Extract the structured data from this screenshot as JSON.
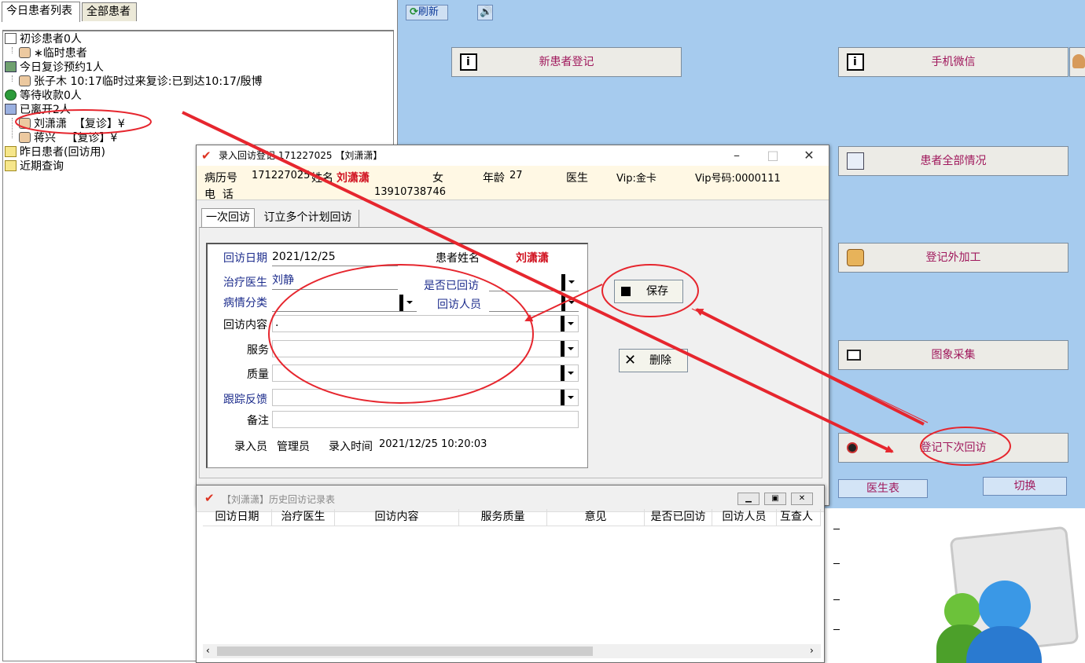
{
  "left_panel": {
    "tabs": [
      "今日患者列表",
      "全部患者"
    ],
    "tree": [
      {
        "text": "初诊患者0人",
        "icon": "document-icon"
      },
      {
        "text": "∗临时患者",
        "icon": "patient-face-icon",
        "child": true
      },
      {
        "text": "今日复诊预约1人",
        "icon": "people-icon"
      },
      {
        "text": "张子木 10:17临时过来复诊:已到达10:17/殷博",
        "icon": "patient-face-icon",
        "child": true
      },
      {
        "text": "等待收款0人",
        "icon": "money-bag-icon"
      },
      {
        "text": "已离开2人",
        "icon": "book-icon"
      },
      {
        "text": "刘潇潇  【复诊】¥",
        "icon": "patient-face-icon",
        "child": true
      },
      {
        "text": "蒋兴   【复诊】¥",
        "icon": "patient-face-icon",
        "child": true
      },
      {
        "text": "昨日患者(回访用)",
        "icon": "folder-icon"
      },
      {
        "text": "近期查询",
        "icon": "folder-icon"
      }
    ]
  },
  "toolbar": {
    "refresh": "刷新"
  },
  "right_buttons": {
    "new_patient": "新患者登记",
    "wechat": "手机微信",
    "all_info": "患者全部情况",
    "outsourcing": "登记外加工",
    "image_capture": "图象采集",
    "next_visit": "登记下次回访",
    "doctor_table": "医生表",
    "switch": "切换"
  },
  "dialog": {
    "title": "录入回访登记 171227025 【刘潇潇】",
    "header": {
      "record_label": "病历号",
      "record_no": "171227025",
      "name_label": "姓名",
      "name": "刘潇潇",
      "gender": "女",
      "age_label": "年龄",
      "age": "27",
      "doctor_label": "医生",
      "vip": "Vip:金卡",
      "vip_no": "Vip号码:0000111",
      "phone_label": "电  话",
      "phone": "13910738746"
    },
    "tabs": [
      "一次回访",
      "订立多个计划回访"
    ],
    "form": {
      "visit_date_label": "回访日期",
      "visit_date": "2021/12/25",
      "patient_name_label": "患者姓名",
      "patient_name": "刘潇潇",
      "doctor_label": "治疗医生",
      "doctor": "刘静",
      "visited_label": "是否已回访",
      "category_label": "病情分类",
      "visitor_label": "回访人员",
      "content_label": "回访内容",
      "content": ".",
      "service_label": "服务",
      "quality_label": "质量",
      "feedback_label": "跟踪反馈",
      "note_label": "备注",
      "entry_by_label": "录入员",
      "entry_by": "管理员",
      "entry_time_label": "录入时间",
      "entry_time": "2021/12/25 10:20:03"
    },
    "buttons": {
      "save": "保存",
      "delete": "删除"
    }
  },
  "history": {
    "title": "【刘潇潇】历史回访记录表",
    "columns": [
      "回访日期",
      "治疗医生",
      "回访内容",
      "服务质量",
      "意见",
      "是否已回访",
      "回访人员",
      "互查人"
    ]
  },
  "colors": {
    "annotation": "#e6262e",
    "desktop": "#a6cbee",
    "accent_text": "#a0185c"
  }
}
